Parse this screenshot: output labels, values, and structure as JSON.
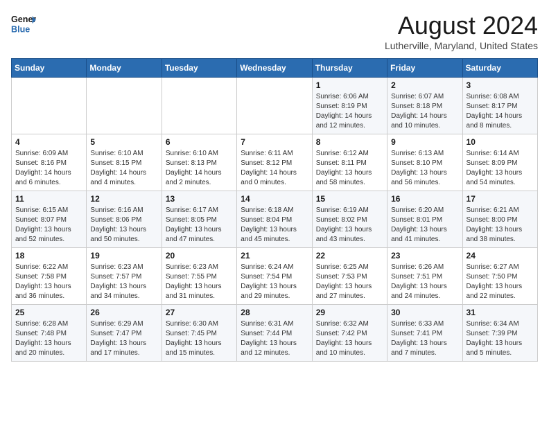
{
  "header": {
    "logo_line1": "General",
    "logo_line2": "Blue",
    "month_title": "August 2024",
    "location": "Lutherville, Maryland, United States"
  },
  "weekdays": [
    "Sunday",
    "Monday",
    "Tuesday",
    "Wednesday",
    "Thursday",
    "Friday",
    "Saturday"
  ],
  "weeks": [
    [
      {
        "day": "",
        "info": ""
      },
      {
        "day": "",
        "info": ""
      },
      {
        "day": "",
        "info": ""
      },
      {
        "day": "",
        "info": ""
      },
      {
        "day": "1",
        "info": "Sunrise: 6:06 AM\nSunset: 8:19 PM\nDaylight: 14 hours\nand 12 minutes."
      },
      {
        "day": "2",
        "info": "Sunrise: 6:07 AM\nSunset: 8:18 PM\nDaylight: 14 hours\nand 10 minutes."
      },
      {
        "day": "3",
        "info": "Sunrise: 6:08 AM\nSunset: 8:17 PM\nDaylight: 14 hours\nand 8 minutes."
      }
    ],
    [
      {
        "day": "4",
        "info": "Sunrise: 6:09 AM\nSunset: 8:16 PM\nDaylight: 14 hours\nand 6 minutes."
      },
      {
        "day": "5",
        "info": "Sunrise: 6:10 AM\nSunset: 8:15 PM\nDaylight: 14 hours\nand 4 minutes."
      },
      {
        "day": "6",
        "info": "Sunrise: 6:10 AM\nSunset: 8:13 PM\nDaylight: 14 hours\nand 2 minutes."
      },
      {
        "day": "7",
        "info": "Sunrise: 6:11 AM\nSunset: 8:12 PM\nDaylight: 14 hours\nand 0 minutes."
      },
      {
        "day": "8",
        "info": "Sunrise: 6:12 AM\nSunset: 8:11 PM\nDaylight: 13 hours\nand 58 minutes."
      },
      {
        "day": "9",
        "info": "Sunrise: 6:13 AM\nSunset: 8:10 PM\nDaylight: 13 hours\nand 56 minutes."
      },
      {
        "day": "10",
        "info": "Sunrise: 6:14 AM\nSunset: 8:09 PM\nDaylight: 13 hours\nand 54 minutes."
      }
    ],
    [
      {
        "day": "11",
        "info": "Sunrise: 6:15 AM\nSunset: 8:07 PM\nDaylight: 13 hours\nand 52 minutes."
      },
      {
        "day": "12",
        "info": "Sunrise: 6:16 AM\nSunset: 8:06 PM\nDaylight: 13 hours\nand 50 minutes."
      },
      {
        "day": "13",
        "info": "Sunrise: 6:17 AM\nSunset: 8:05 PM\nDaylight: 13 hours\nand 47 minutes."
      },
      {
        "day": "14",
        "info": "Sunrise: 6:18 AM\nSunset: 8:04 PM\nDaylight: 13 hours\nand 45 minutes."
      },
      {
        "day": "15",
        "info": "Sunrise: 6:19 AM\nSunset: 8:02 PM\nDaylight: 13 hours\nand 43 minutes."
      },
      {
        "day": "16",
        "info": "Sunrise: 6:20 AM\nSunset: 8:01 PM\nDaylight: 13 hours\nand 41 minutes."
      },
      {
        "day": "17",
        "info": "Sunrise: 6:21 AM\nSunset: 8:00 PM\nDaylight: 13 hours\nand 38 minutes."
      }
    ],
    [
      {
        "day": "18",
        "info": "Sunrise: 6:22 AM\nSunset: 7:58 PM\nDaylight: 13 hours\nand 36 minutes."
      },
      {
        "day": "19",
        "info": "Sunrise: 6:23 AM\nSunset: 7:57 PM\nDaylight: 13 hours\nand 34 minutes."
      },
      {
        "day": "20",
        "info": "Sunrise: 6:23 AM\nSunset: 7:55 PM\nDaylight: 13 hours\nand 31 minutes."
      },
      {
        "day": "21",
        "info": "Sunrise: 6:24 AM\nSunset: 7:54 PM\nDaylight: 13 hours\nand 29 minutes."
      },
      {
        "day": "22",
        "info": "Sunrise: 6:25 AM\nSunset: 7:53 PM\nDaylight: 13 hours\nand 27 minutes."
      },
      {
        "day": "23",
        "info": "Sunrise: 6:26 AM\nSunset: 7:51 PM\nDaylight: 13 hours\nand 24 minutes."
      },
      {
        "day": "24",
        "info": "Sunrise: 6:27 AM\nSunset: 7:50 PM\nDaylight: 13 hours\nand 22 minutes."
      }
    ],
    [
      {
        "day": "25",
        "info": "Sunrise: 6:28 AM\nSunset: 7:48 PM\nDaylight: 13 hours\nand 20 minutes."
      },
      {
        "day": "26",
        "info": "Sunrise: 6:29 AM\nSunset: 7:47 PM\nDaylight: 13 hours\nand 17 minutes."
      },
      {
        "day": "27",
        "info": "Sunrise: 6:30 AM\nSunset: 7:45 PM\nDaylight: 13 hours\nand 15 minutes."
      },
      {
        "day": "28",
        "info": "Sunrise: 6:31 AM\nSunset: 7:44 PM\nDaylight: 13 hours\nand 12 minutes."
      },
      {
        "day": "29",
        "info": "Sunrise: 6:32 AM\nSunset: 7:42 PM\nDaylight: 13 hours\nand 10 minutes."
      },
      {
        "day": "30",
        "info": "Sunrise: 6:33 AM\nSunset: 7:41 PM\nDaylight: 13 hours\nand 7 minutes."
      },
      {
        "day": "31",
        "info": "Sunrise: 6:34 AM\nSunset: 7:39 PM\nDaylight: 13 hours\nand 5 minutes."
      }
    ]
  ]
}
